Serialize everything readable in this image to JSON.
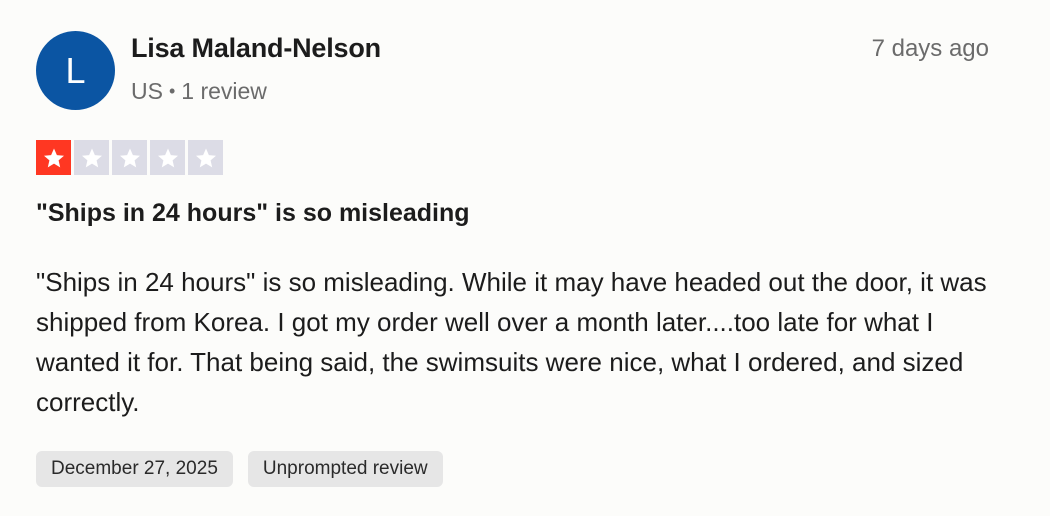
{
  "reviewer": {
    "initial": "L",
    "name": "Lisa Maland-Nelson",
    "country": "US",
    "separator": "•",
    "review_count": "1 review",
    "avatar_color": "#0b55a3"
  },
  "posted_ago": "7 days ago",
  "rating": {
    "value": 1,
    "max": 5,
    "filled_color": "#ff3722",
    "empty_color": "#dcdce6"
  },
  "review": {
    "title": "\"Ships in 24 hours\" is so misleading",
    "text": "\"Ships in 24 hours\" is so misleading. While it may have headed out the door, it was shipped from Korea. I got my order well over a month later....too late for what I wanted it for. That being said, the swimsuits were nice, what I ordered, and sized correctly."
  },
  "tags": {
    "experience_date": "December 27, 2025",
    "review_type": "Unprompted review"
  }
}
